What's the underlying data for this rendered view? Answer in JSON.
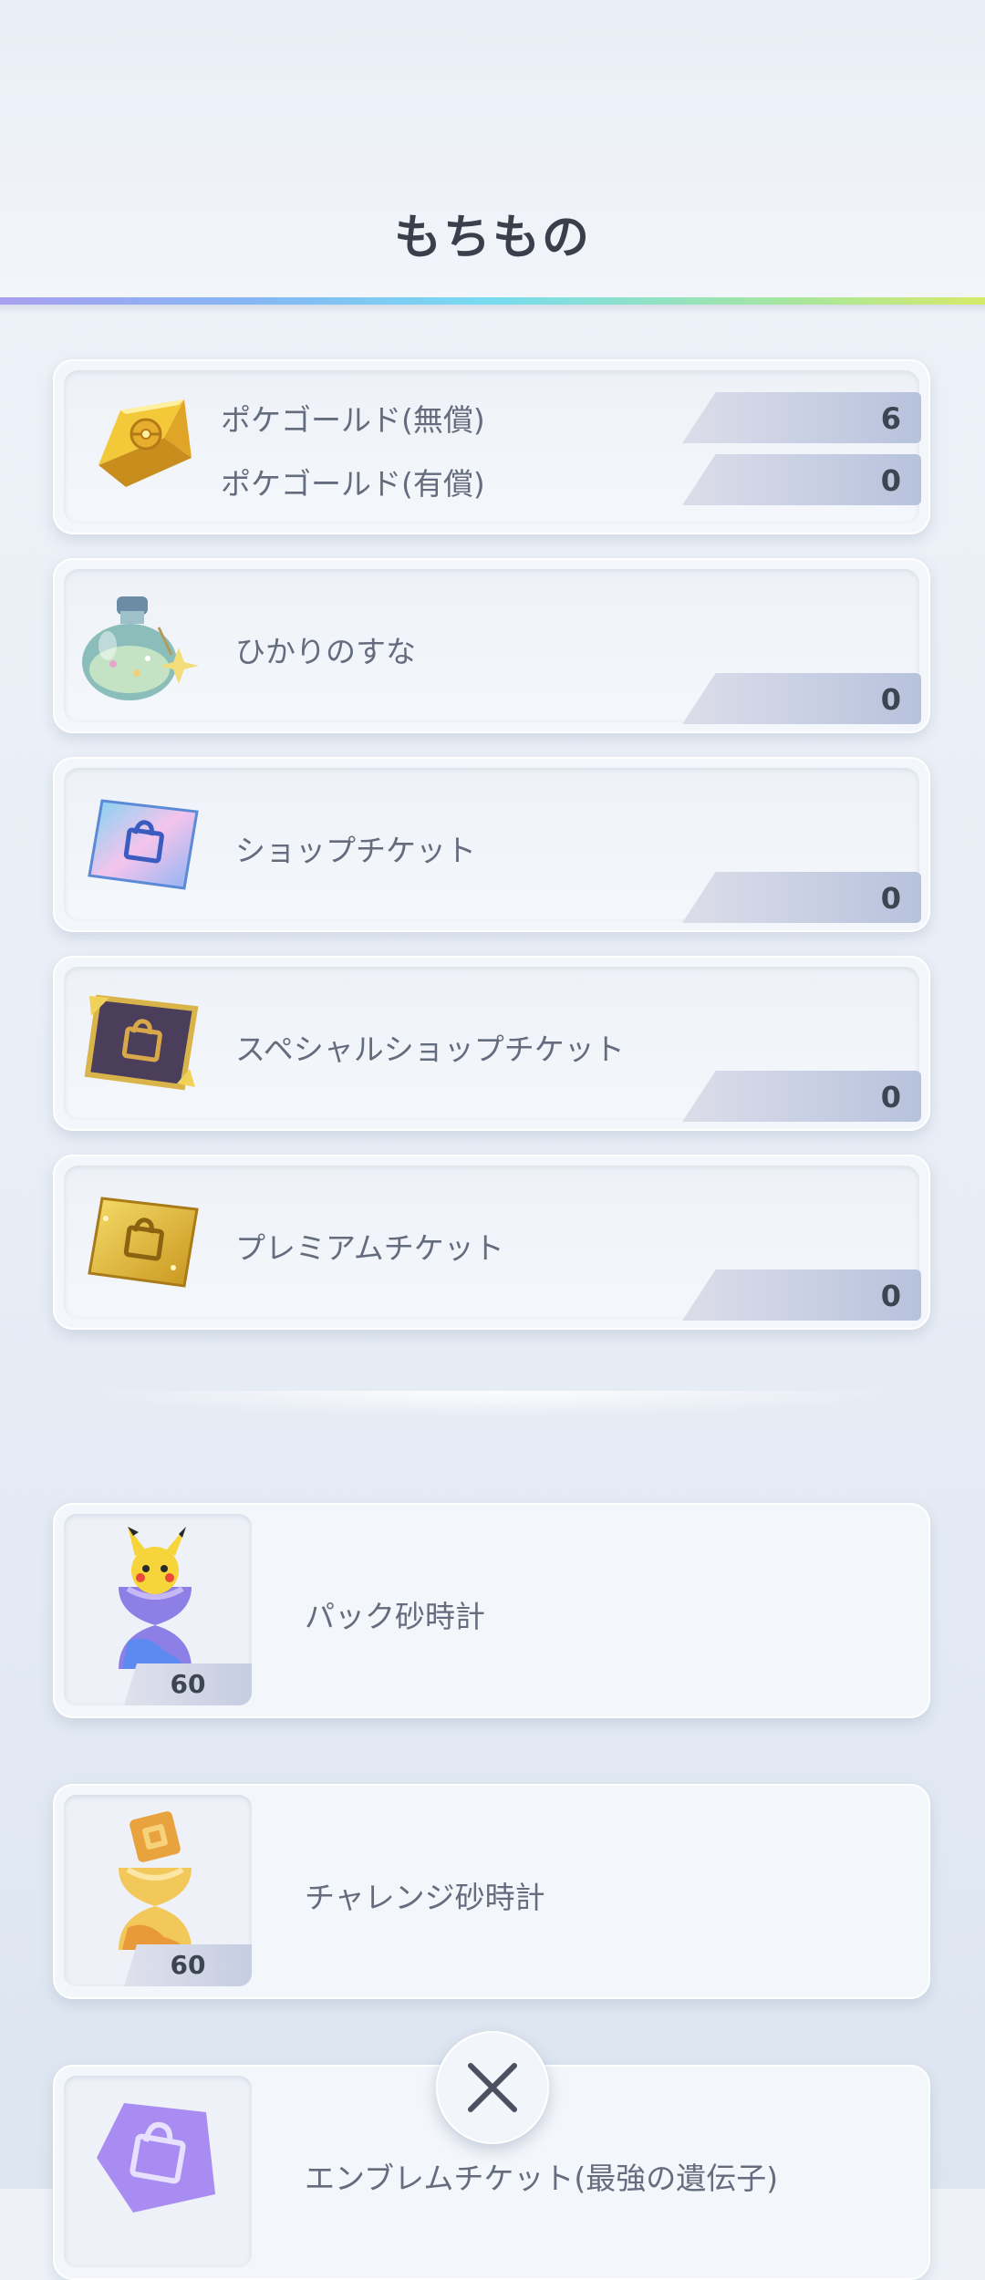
{
  "header": {
    "title": "もちもの"
  },
  "currency_card": {
    "rows": [
      {
        "label": "ポケゴールド(無償)",
        "count": "6"
      },
      {
        "label": "ポケゴールド(有償)",
        "count": "0"
      }
    ]
  },
  "items": [
    {
      "label": "ひかりのすな",
      "count": "0",
      "icon": "stardust-bottle-icon"
    },
    {
      "label": "ショップチケット",
      "count": "0",
      "icon": "shop-ticket-icon"
    },
    {
      "label": "スペシャルショップチケット",
      "count": "0",
      "icon": "special-shop-ticket-icon"
    },
    {
      "label": "プレミアムチケット",
      "count": "0",
      "icon": "premium-ticket-icon"
    }
  ],
  "hourglasses": [
    {
      "label": "パック砂時計",
      "count": "60",
      "icon": "pack-hourglass-icon"
    },
    {
      "label": "チャレンジ砂時計",
      "count": "60",
      "icon": "challenge-hourglass-icon"
    },
    {
      "label": "エンブレムチケット(最強の遺伝子)",
      "icon": "emblem-ticket-icon"
    }
  ],
  "close_button": {
    "icon": "close-icon"
  },
  "colors": {
    "accent_rainbow": [
      "#a9a0f0",
      "#78dcf0",
      "#d6ea6a"
    ],
    "count_bar": "#c8cfe3",
    "title_text": "#3a3f4c"
  }
}
